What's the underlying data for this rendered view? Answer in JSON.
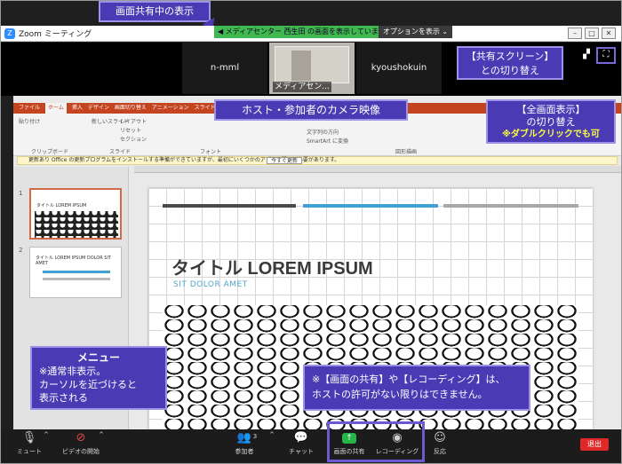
{
  "window": {
    "title": "Zoom ミーティング",
    "controls": [
      "–",
      "□",
      "✕"
    ]
  },
  "share_bar": {
    "status": "◀ メディアセンター 西生田 の画面を表示しています",
    "options_label": "オプションを表示 ⌄"
  },
  "callouts": {
    "top": "画面共有中の表示",
    "share_switch_1": "【共有スクリーン】",
    "share_switch_2": "との切り替え",
    "camera": "ホスト・参加者のカメラ映像",
    "fullscreen_1": "【全画面表示】",
    "fullscreen_2": "の切り替え",
    "fullscreen_3": "※ダブルクリックでも可",
    "menu_heading": "メニュー",
    "menu_1": "※通常非表示。",
    "menu_2": "カーソルを近づけると",
    "menu_3": "表示される",
    "perm_1": "※【画面の共有】や【レコーディング】は、",
    "perm_2": "ホストの許可がない限りはできません。"
  },
  "gallery": {
    "participants": [
      {
        "name": "n-mml"
      },
      {
        "name": "メディアセン..."
      },
      {
        "name": "kyoushokuin"
      }
    ]
  },
  "powerpoint": {
    "tabs": [
      "ファイル",
      "ホーム",
      "挿入",
      "デザイン",
      "画面切り替え",
      "アニメーション",
      "スライド ショー",
      "校閲"
    ],
    "groups": [
      "クリップボード",
      "スライド",
      "フォント",
      "図形描画"
    ],
    "ribbon_items": [
      "貼り付け",
      "新しいスライド",
      "レイアウト",
      "リセット",
      "セクション",
      "文字列の方向",
      "文字の配置",
      "SmartArt に変換"
    ],
    "notice": "更新あり  Office の更新プログラムをインストールする準備ができていますが、最初にいくつかのアプリを閉じる必要があります。",
    "notice_button": "今すぐ更新",
    "thumbs": [
      {
        "num": "1",
        "title": "タイトル LOREM IPSUM"
      },
      {
        "num": "2",
        "title": "タイトル LOREM IPSUM DOLOR SIT AMET"
      }
    ],
    "slide": {
      "title": "タイトル LOREM IPSUM",
      "subtitle": "SIT DOLOR AMET",
      "line_colors": [
        "#4a4a4a",
        "#3ea1d0",
        "#a8a8a8"
      ]
    }
  },
  "toolbar": {
    "mute": "ミュート",
    "video": "ビデオの開始",
    "participants": "参加者",
    "participants_count": "3",
    "chat": "チャット",
    "share": "画面の共有",
    "record": "レコーディング",
    "reactions": "反応",
    "end": "退出"
  },
  "colors": {
    "callout": "#4a3bb5",
    "share_green": "#3fb84f",
    "ppt_accent": "#c4441f",
    "end_red": "#e02828"
  },
  "icons": [
    "microphone-icon",
    "video-off-icon",
    "participants-icon",
    "chat-icon",
    "share-screen-icon",
    "record-icon",
    "reaction-icon",
    "speaker-view-icon",
    "fullscreen-icon",
    "zoom-logo-icon"
  ]
}
